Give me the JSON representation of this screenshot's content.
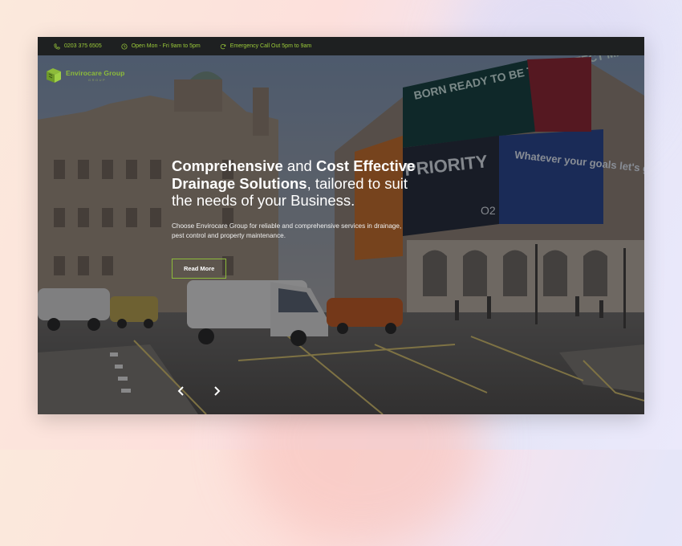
{
  "topbar": {
    "phone": "0203 375 6505",
    "hours": "Open Mon - Fri 9am to 5pm",
    "emergency": "Emergency Call Out 5pm to 9am"
  },
  "logo": {
    "name": "Envirocare Group",
    "tagline": "GROUP"
  },
  "hero": {
    "headline_bold_1": "Comprehensive",
    "headline_mid": " and ",
    "headline_bold_2": "Cost Effective Drainage Solutions",
    "headline_rest": ", tailored to suit the needs of your Business.",
    "description": "Choose Envirocare Group for reliable and comprehensive services in drainage, pest control and property maintenance.",
    "cta_label": "Read More"
  },
  "billboards": {
    "top": "BORN READY TO BE THE PERFECT MATCH.",
    "priority": "PRIORITY",
    "o2": "O2",
    "goals": "Whatever your goals let's get going"
  },
  "colors": {
    "accent": "#8dbb3a",
    "topbar_bg": "#1e2021"
  }
}
